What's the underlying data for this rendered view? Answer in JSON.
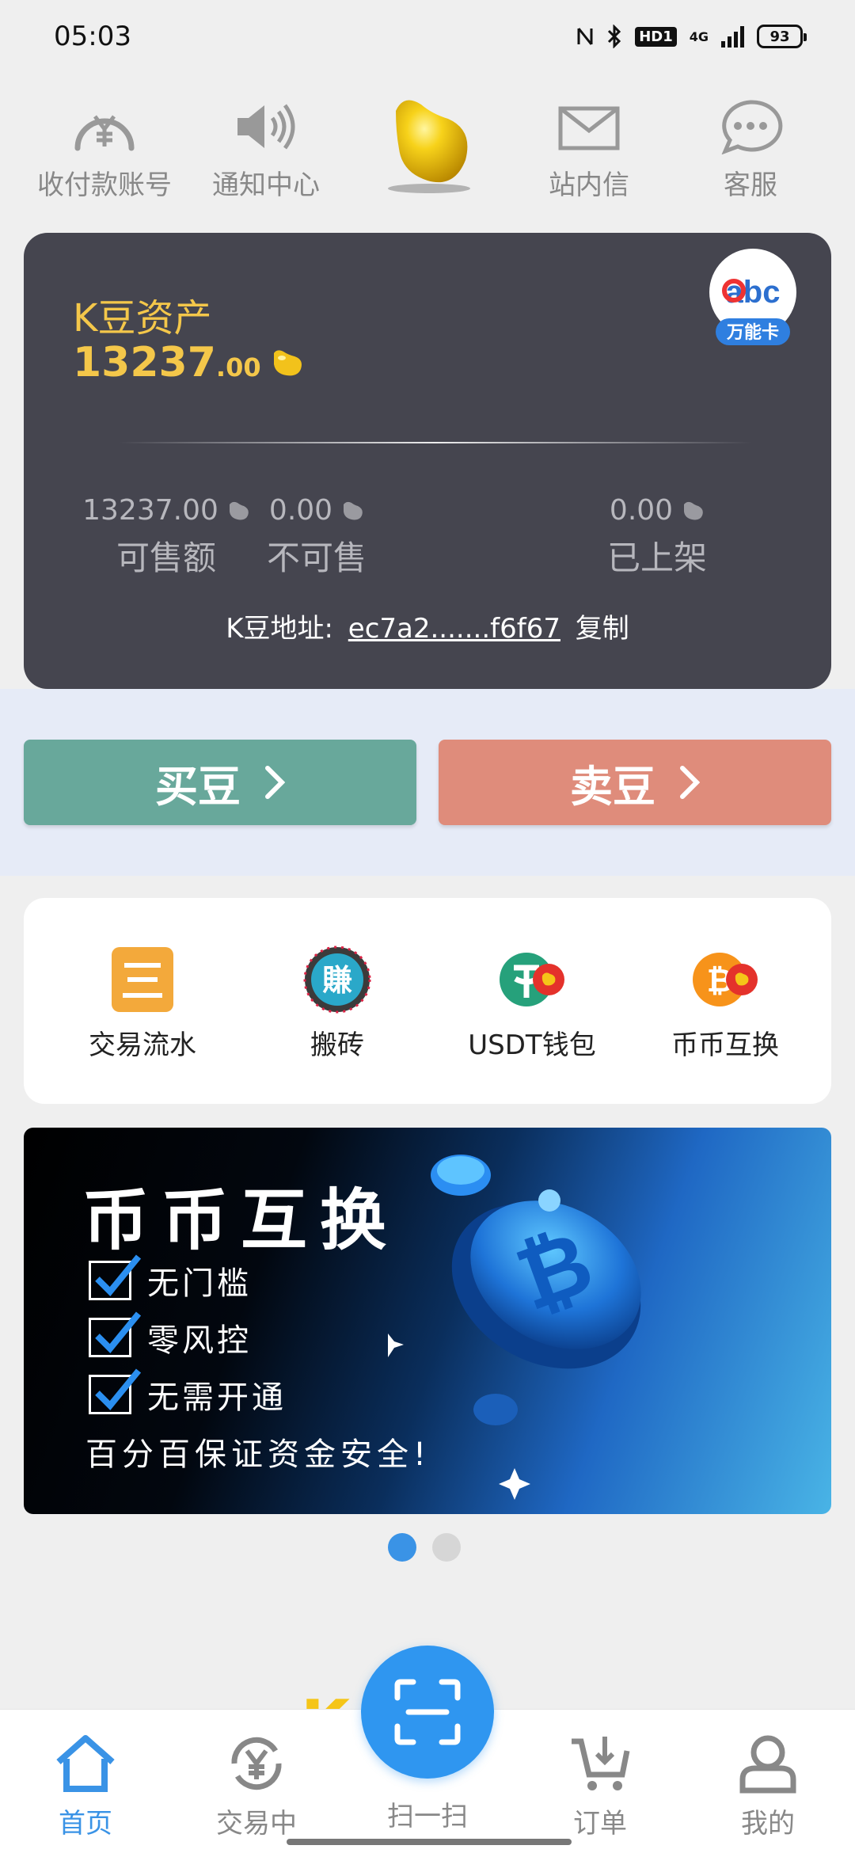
{
  "status_bar": {
    "time": "05:03",
    "hd": "HD1",
    "network": "4G",
    "battery": "93",
    "icons": [
      "nfc-icon",
      "bluetooth-icon",
      "hd-icon",
      "signal-icon",
      "battery-icon"
    ]
  },
  "top_nav": {
    "items": [
      {
        "label": "收付款账号",
        "icon": "yuan-dial-icon"
      },
      {
        "label": "通知中心",
        "icon": "speaker-icon"
      },
      {
        "label": "",
        "icon": "gold-bean-icon"
      },
      {
        "label": "站内信",
        "icon": "envelope-icon"
      },
      {
        "label": "客服",
        "icon": "chat-bubble-icon"
      }
    ]
  },
  "asset_card": {
    "title": "K豆资产",
    "amount_int": "13237",
    "amount_dec": ".00",
    "badge_text": "万能卡",
    "badge_logo": "abc",
    "stats": [
      {
        "value": "13237.00",
        "label": "可售额"
      },
      {
        "value": "0.00",
        "label": "不可售"
      },
      {
        "value": "0.00",
        "label": "已上架"
      }
    ],
    "address_label": "K豆地址:",
    "address_value": "ec7a2.......f6f67",
    "copy_label": "复制"
  },
  "trade": {
    "buy_label": "买豆",
    "sell_label": "卖豆",
    "buy_color": "#68a89b",
    "sell_color": "#df8c7b"
  },
  "quick_actions": [
    {
      "label": "交易流水",
      "icon": "ledger-icon"
    },
    {
      "label": "搬砖",
      "icon": "earn-badge-icon"
    },
    {
      "label": "USDT钱包",
      "icon": "usdt-wallet-icon"
    },
    {
      "label": "币币互换",
      "icon": "bitcoin-swap-icon"
    }
  ],
  "banner": {
    "title": "币币互换",
    "checks": [
      "无门槛",
      "零风控",
      "无需开通"
    ],
    "footer": "百分百保证资金安全!"
  },
  "carousel": {
    "count": 2,
    "active": 0
  },
  "brand_peek": "K   ay",
  "tabbar": {
    "items": [
      {
        "label": "首页",
        "icon": "home-icon",
        "active": true
      },
      {
        "label": "交易中",
        "icon": "yuan-exchange-icon",
        "active": false
      },
      {
        "label": "扫一扫",
        "icon": "scan-icon",
        "active": false
      },
      {
        "label": "订单",
        "icon": "cart-icon",
        "active": false
      },
      {
        "label": "我的",
        "icon": "user-icon",
        "active": false
      }
    ]
  },
  "colors": {
    "accent": "#3a93e6",
    "gold": "#f4c74a",
    "card_bg": "#45454f"
  }
}
